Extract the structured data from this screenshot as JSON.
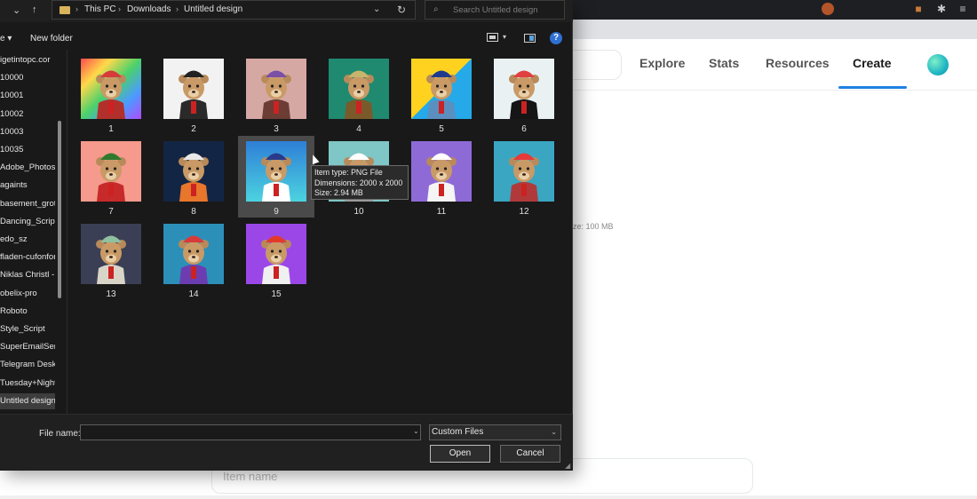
{
  "dialog": {
    "breadcrumb": [
      "This PC",
      "Downloads",
      "Untitled design"
    ],
    "search_placeholder": "Search Untitled design",
    "organize_label": "e",
    "new_folder_label": "New folder",
    "help_label": "?",
    "nav_items": [
      {
        "label": "igetintopc.cor",
        "selected": false
      },
      {
        "label": "10000",
        "selected": false
      },
      {
        "label": "10001",
        "selected": false
      },
      {
        "label": "10002",
        "selected": false
      },
      {
        "label": "10003",
        "selected": false
      },
      {
        "label": "10035",
        "selected": false
      },
      {
        "label": "Adobe_Photosl",
        "selected": false
      },
      {
        "label": "againts",
        "selected": false
      },
      {
        "label": "basement_grot",
        "selected": false
      },
      {
        "label": "Dancing_Script",
        "selected": false
      },
      {
        "label": "edo_sz",
        "selected": false
      },
      {
        "label": "fladen-cufonfor",
        "selected": false
      },
      {
        "label": "Niklas Christl -",
        "selected": false
      },
      {
        "label": "obelix-pro",
        "selected": false
      },
      {
        "label": "Roboto",
        "selected": false
      },
      {
        "label": "Style_Script",
        "selected": false
      },
      {
        "label": "SuperEmailSen",
        "selected": false
      },
      {
        "label": "Telegram Desk",
        "selected": false
      },
      {
        "label": "Tuesday+Night",
        "selected": false
      },
      {
        "label": "Untitled design",
        "selected": true
      }
    ],
    "files": [
      {
        "name": "1",
        "bg": "linear-gradient(135deg,#ff4b4b,#ffd94a,#4bd16b,#4b9bff,#b04bff)",
        "hat": "#d63a3a",
        "shirt": "#b2302b",
        "selected": false
      },
      {
        "name": "2",
        "bg": "#f2f2f2",
        "hat": "#222222",
        "shirt": "#2a2a2a",
        "selected": false
      },
      {
        "name": "3",
        "bg": "#d6a8a4",
        "hat": "#7a4fa6",
        "shirt": "#6b3d34",
        "selected": false
      },
      {
        "name": "4",
        "bg": "#1f8a70",
        "hat": "#c8b46a",
        "shirt": "#7a5a2a",
        "selected": false
      },
      {
        "name": "5",
        "bg": "linear-gradient(135deg,#ffd21f 50%,#25a9e8 50%)",
        "hat": "#1e3b8f",
        "shirt": "#5b8fbf",
        "selected": false
      },
      {
        "name": "6",
        "bg": "#e9f1f3",
        "hat": "#e04040",
        "shirt": "#151515",
        "selected": false
      },
      {
        "name": "7",
        "bg": "#f59a8c",
        "hat": "#2f7a2f",
        "shirt": "#c72a2a",
        "selected": false
      },
      {
        "name": "8",
        "bg": "#132544",
        "hat": "#e8e8e8",
        "shirt": "#e8762b",
        "selected": false
      },
      {
        "name": "9",
        "bg": "linear-gradient(180deg,#2e7fd6,#4cd3e0)",
        "hat": "#2a3a8a",
        "shirt": "#ffffff",
        "selected": true
      },
      {
        "name": "10",
        "bg": "#7fc6c6",
        "hat": "#ffffff",
        "shirt": "#9a9a9a",
        "selected": false
      },
      {
        "name": "11",
        "bg": "#8e6ad6",
        "hat": "#ffffff",
        "shirt": "#f5f5f5",
        "selected": false
      },
      {
        "name": "12",
        "bg": "#3aa6c2",
        "hat": "#e53a3a",
        "shirt": "#b03a3a",
        "selected": false
      },
      {
        "name": "13",
        "bg": "#3b3f55",
        "hat": "#8fc0a0",
        "shirt": "#d9d4c8",
        "selected": false
      },
      {
        "name": "14",
        "bg": "#2c8fb8",
        "hat": "#d83a3a",
        "shirt": "#6b3db0",
        "selected": false
      },
      {
        "name": "15",
        "bg": "#9b47e8",
        "hat": "#e23a2a",
        "shirt": "#f0f0f0",
        "selected": false
      }
    ],
    "tooltip": {
      "type": "Item type: PNG File",
      "dimensions": "Dimensions: 2000 x 2000",
      "size": "Size: 2.94 MB"
    },
    "file_name_label": "File name:",
    "file_name_value": "",
    "filter_value": "Custom Files",
    "open_label": "Open",
    "cancel_label": "Cancel"
  },
  "site": {
    "nav": [
      "Explore",
      "Stats",
      "Resources",
      "Create"
    ],
    "active_nav": "Create",
    "accent": "#2081e2",
    "size_hint": "ze: 100 MB",
    "item_name_placeholder": "Item name"
  }
}
